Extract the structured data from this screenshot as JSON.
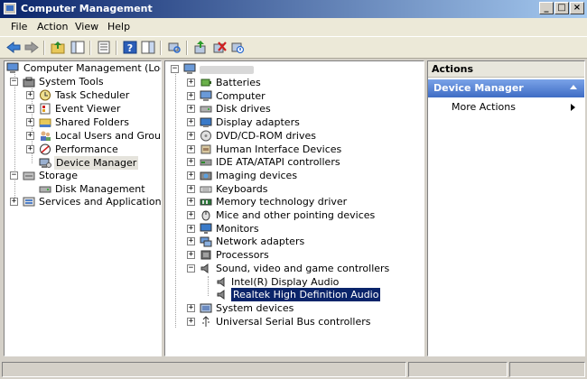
{
  "window": {
    "title": "Computer Management",
    "controls": [
      "_",
      "□",
      "×"
    ]
  },
  "menu": [
    "File",
    "Action",
    "View",
    "Help"
  ],
  "toolbar_icons": [
    "back-arrow-icon",
    "forward-arrow-icon",
    "up-folder-icon",
    "show-hide-tree-icon",
    "properties-icon",
    "help-icon",
    "show-hide-action-pane-icon",
    "scan-hardware-icon",
    "update-driver-icon",
    "uninstall-icon",
    "disable-device-icon"
  ],
  "left_tree": {
    "root": "Computer Management (Local)",
    "system_tools": "System Tools",
    "task_scheduler": "Task Scheduler",
    "event_viewer": "Event Viewer",
    "shared_folders": "Shared Folders",
    "local_users": "Local Users and Groups",
    "performance": "Performance",
    "device_manager": "Device Manager",
    "storage": "Storage",
    "disk_management": "Disk Management",
    "services": "Services and Applications"
  },
  "devices": {
    "items": [
      "Batteries",
      "Computer",
      "Disk drives",
      "Display adapters",
      "DVD/CD-ROM drives",
      "Human Interface Devices",
      "IDE ATA/ATAPI controllers",
      "Imaging devices",
      "Keyboards",
      "Memory technology driver",
      "Mice and other pointing devices",
      "Monitors",
      "Network adapters",
      "Processors",
      "Sound, video and game controllers"
    ],
    "sound_children": [
      "Intel(R) Display Audio",
      "Realtek High Definition Audio"
    ],
    "after": [
      "System devices",
      "Universal Serial Bus controllers"
    ]
  },
  "actions": {
    "header": "Actions",
    "section": "Device Manager",
    "more": "More Actions"
  }
}
